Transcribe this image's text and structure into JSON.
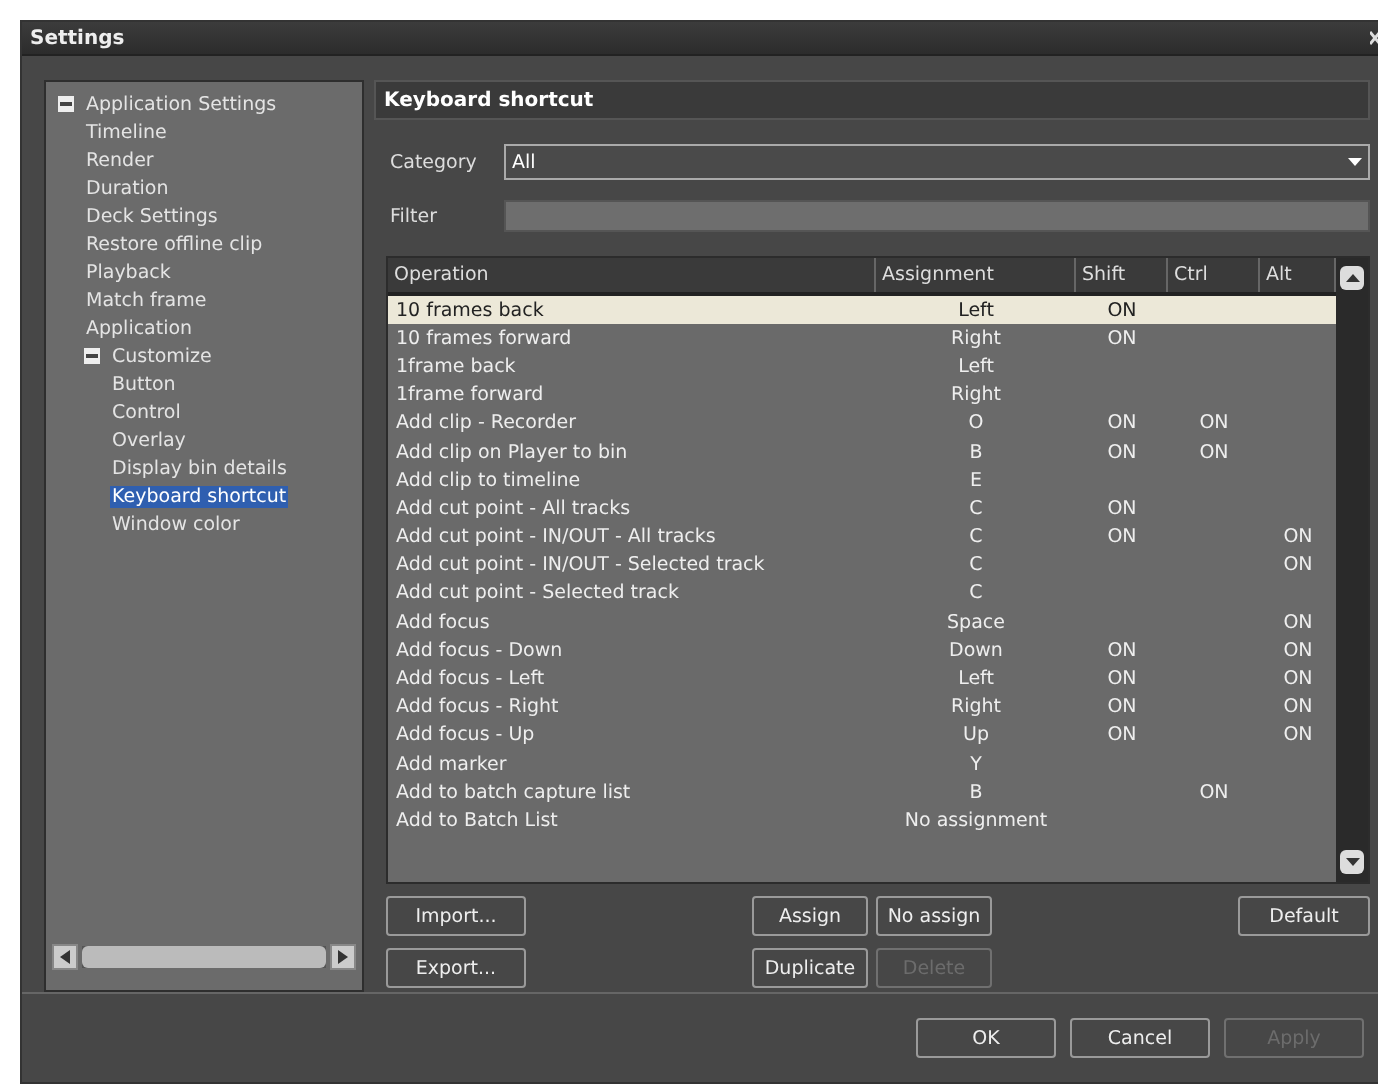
{
  "window": {
    "title": "Settings"
  },
  "sidebar": {
    "tree": [
      {
        "label": "Application Settings",
        "expanded": true,
        "selected": false,
        "children": [
          {
            "label": "Timeline",
            "selected": false
          },
          {
            "label": "Render",
            "selected": false
          },
          {
            "label": "Duration",
            "selected": false
          },
          {
            "label": "Deck Settings",
            "selected": false
          },
          {
            "label": "Restore offline clip",
            "selected": false
          },
          {
            "label": "Playback",
            "selected": false
          },
          {
            "label": "Match frame",
            "selected": false
          },
          {
            "label": "Application",
            "selected": false
          },
          {
            "label": "Customize",
            "expanded": true,
            "selected": false,
            "children": [
              {
                "label": "Button",
                "selected": false
              },
              {
                "label": "Control",
                "selected": false
              },
              {
                "label": "Overlay",
                "selected": false
              },
              {
                "label": "Display bin details",
                "selected": false
              },
              {
                "label": "Keyboard shortcut",
                "selected": true
              },
              {
                "label": "Window color",
                "selected": false
              }
            ]
          }
        ]
      }
    ]
  },
  "panel": {
    "title": "Keyboard shortcut",
    "category": {
      "label": "Category",
      "value": "All"
    },
    "filter": {
      "label": "Filter"
    },
    "table": {
      "columns": [
        "Operation",
        "Assignment",
        "Shift",
        "Ctrl",
        "Alt"
      ],
      "rows": [
        {
          "cells": [
            "10 frames back",
            "Left",
            "ON",
            "",
            ""
          ],
          "selected": true
        },
        {
          "cells": [
            "10 frames forward",
            "Right",
            "ON",
            "",
            ""
          ],
          "selected": false
        },
        {
          "cells": [
            "1frame back",
            "Left",
            "",
            "",
            ""
          ],
          "selected": false
        },
        {
          "cells": [
            "1frame forward",
            "Right",
            "",
            "",
            ""
          ],
          "selected": false
        },
        {
          "cells": [
            "Add clip - Recorder",
            "O",
            "ON",
            "ON",
            ""
          ],
          "selected": false
        },
        {
          "cells": [
            "Add clip on Player to bin",
            "B",
            "ON",
            "ON",
            ""
          ],
          "selected": false
        },
        {
          "cells": [
            "Add clip to timeline",
            "E",
            "",
            "",
            ""
          ],
          "selected": false
        },
        {
          "cells": [
            "Add cut point - All tracks",
            "C",
            "ON",
            "",
            ""
          ],
          "selected": false
        },
        {
          "cells": [
            "Add cut point - IN/OUT - All tracks",
            "C",
            "ON",
            "",
            "ON"
          ],
          "selected": false
        },
        {
          "cells": [
            "Add cut point - IN/OUT - Selected track",
            "C",
            "",
            "",
            "ON"
          ],
          "selected": false
        },
        {
          "cells": [
            "Add cut point - Selected track",
            "C",
            "",
            "",
            ""
          ],
          "selected": false
        },
        {
          "cells": [
            "Add focus",
            "Space",
            "",
            "",
            "ON"
          ],
          "selected": false
        },
        {
          "cells": [
            "Add focus - Down",
            "Down",
            "ON",
            "",
            "ON"
          ],
          "selected": false
        },
        {
          "cells": [
            "Add focus - Left",
            "Left",
            "ON",
            "",
            "ON"
          ],
          "selected": false
        },
        {
          "cells": [
            "Add focus - Right",
            "Right",
            "ON",
            "",
            "ON"
          ],
          "selected": false
        },
        {
          "cells": [
            "Add focus - Up",
            "Up",
            "ON",
            "",
            "ON"
          ],
          "selected": false
        },
        {
          "cells": [
            "Add marker",
            "Y",
            "",
            "",
            ""
          ],
          "selected": false
        },
        {
          "cells": [
            "Add to batch capture list",
            "B",
            "",
            "ON",
            ""
          ],
          "selected": false
        },
        {
          "cells": [
            "Add to Batch List",
            "No assignment",
            "",
            "",
            ""
          ],
          "selected": false
        }
      ]
    },
    "buttons": [
      {
        "label": "Import...",
        "disabled": false
      },
      {
        "label": "Assign",
        "disabled": false
      },
      {
        "label": "No assign",
        "disabled": false
      },
      {
        "label": "Default",
        "disabled": false
      },
      {
        "label": "Export...",
        "disabled": false
      },
      {
        "label": "Duplicate",
        "disabled": false
      },
      {
        "label": "Delete",
        "disabled": true
      }
    ]
  },
  "footer": {
    "buttons": [
      {
        "label": "OK",
        "disabled": false
      },
      {
        "label": "Cancel",
        "disabled": false
      },
      {
        "label": "Apply",
        "disabled": true
      }
    ]
  }
}
